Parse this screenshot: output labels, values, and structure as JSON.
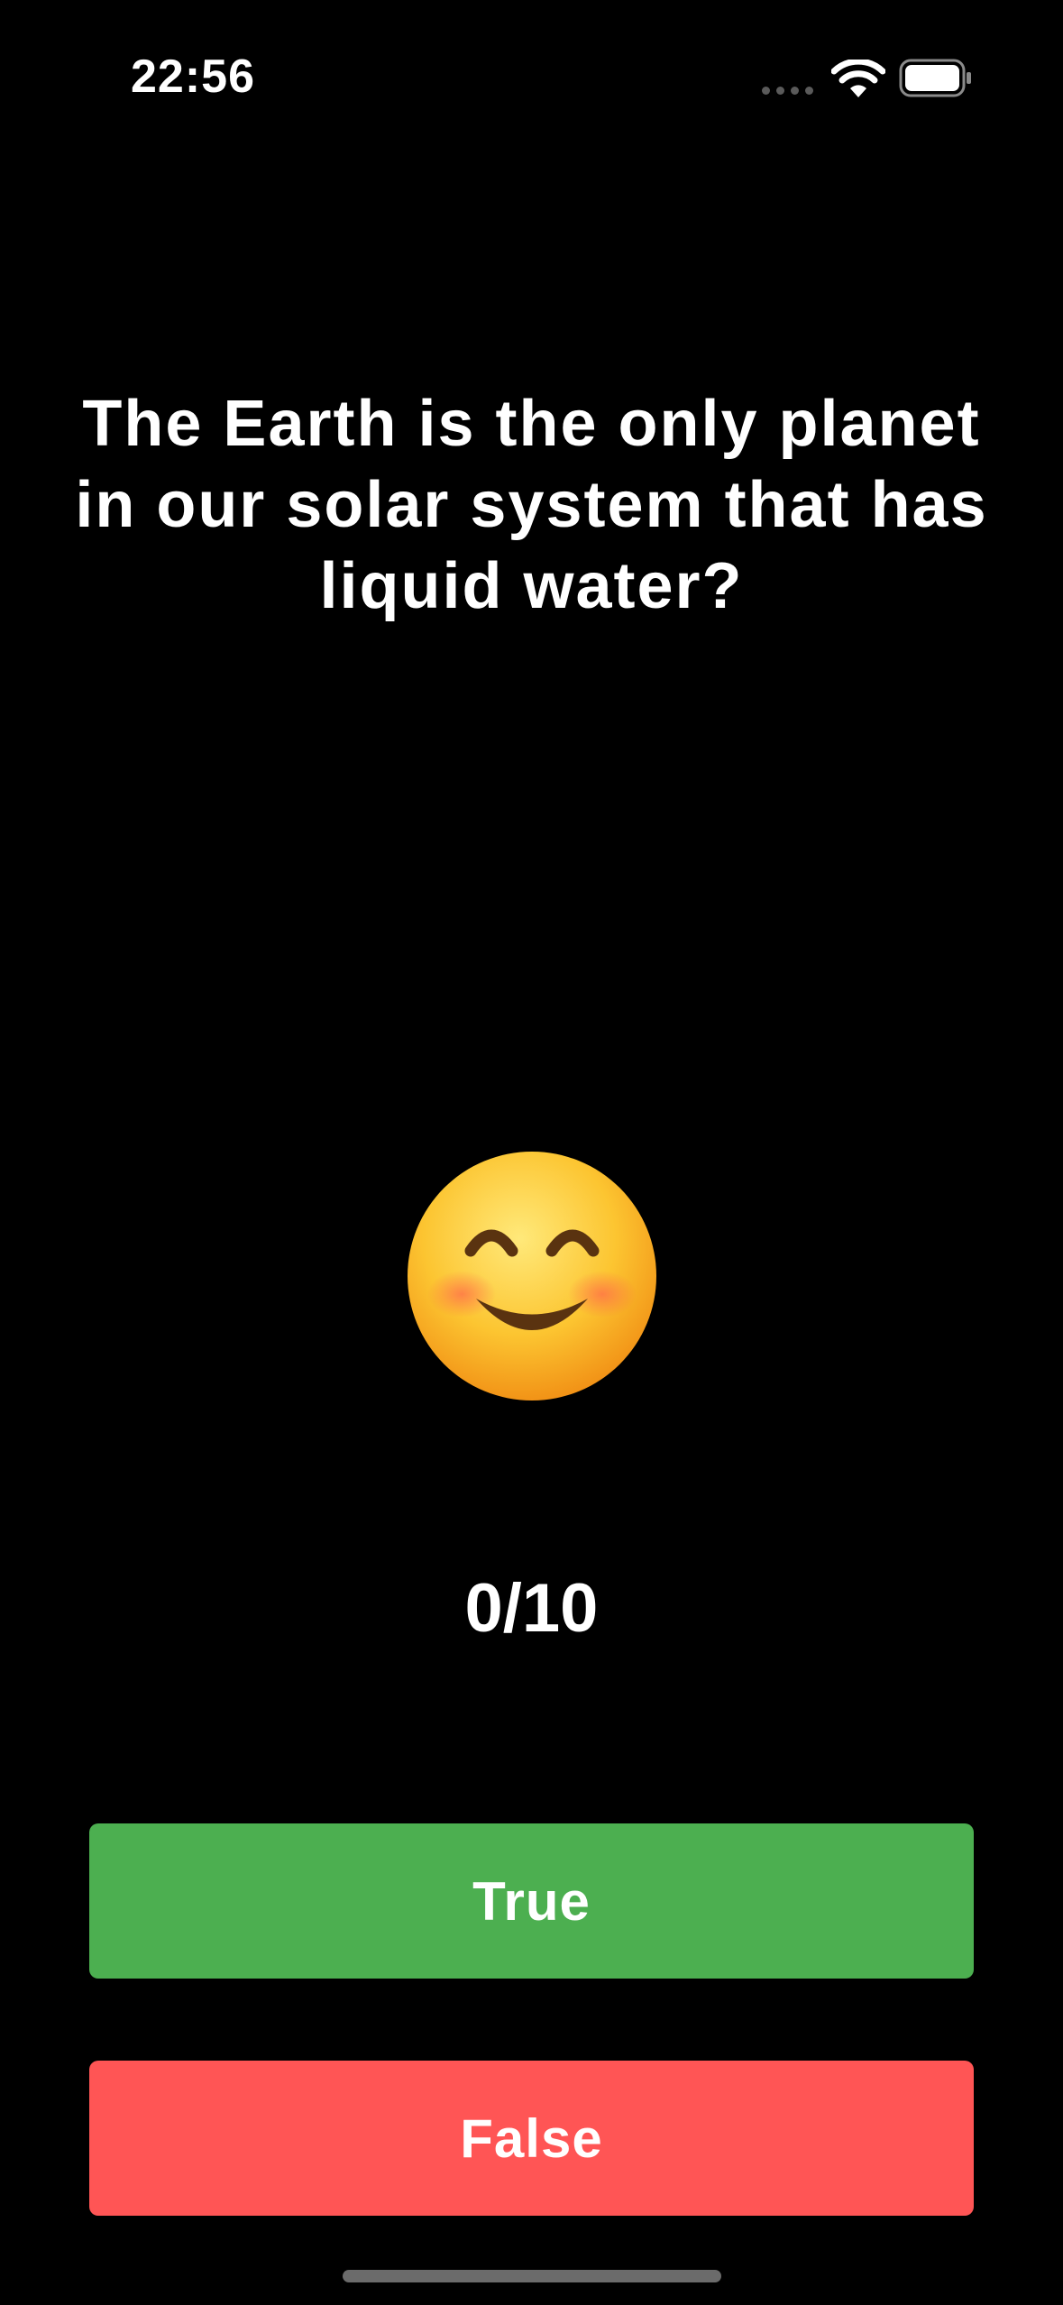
{
  "status_bar": {
    "time": "22:56",
    "icons": [
      "signal-dots-icon",
      "wifi-icon",
      "battery-icon"
    ]
  },
  "quiz": {
    "question": "The Earth is the only planet in our solar system that has liquid water?",
    "feedback_icon": "smiling-face-emoji",
    "score": "0/10"
  },
  "buttons": {
    "true_label": "True",
    "false_label": "False"
  },
  "colors": {
    "background": "#000000",
    "true_button": "#4caf50",
    "false_button": "#ff5555",
    "text": "#ffffff"
  }
}
